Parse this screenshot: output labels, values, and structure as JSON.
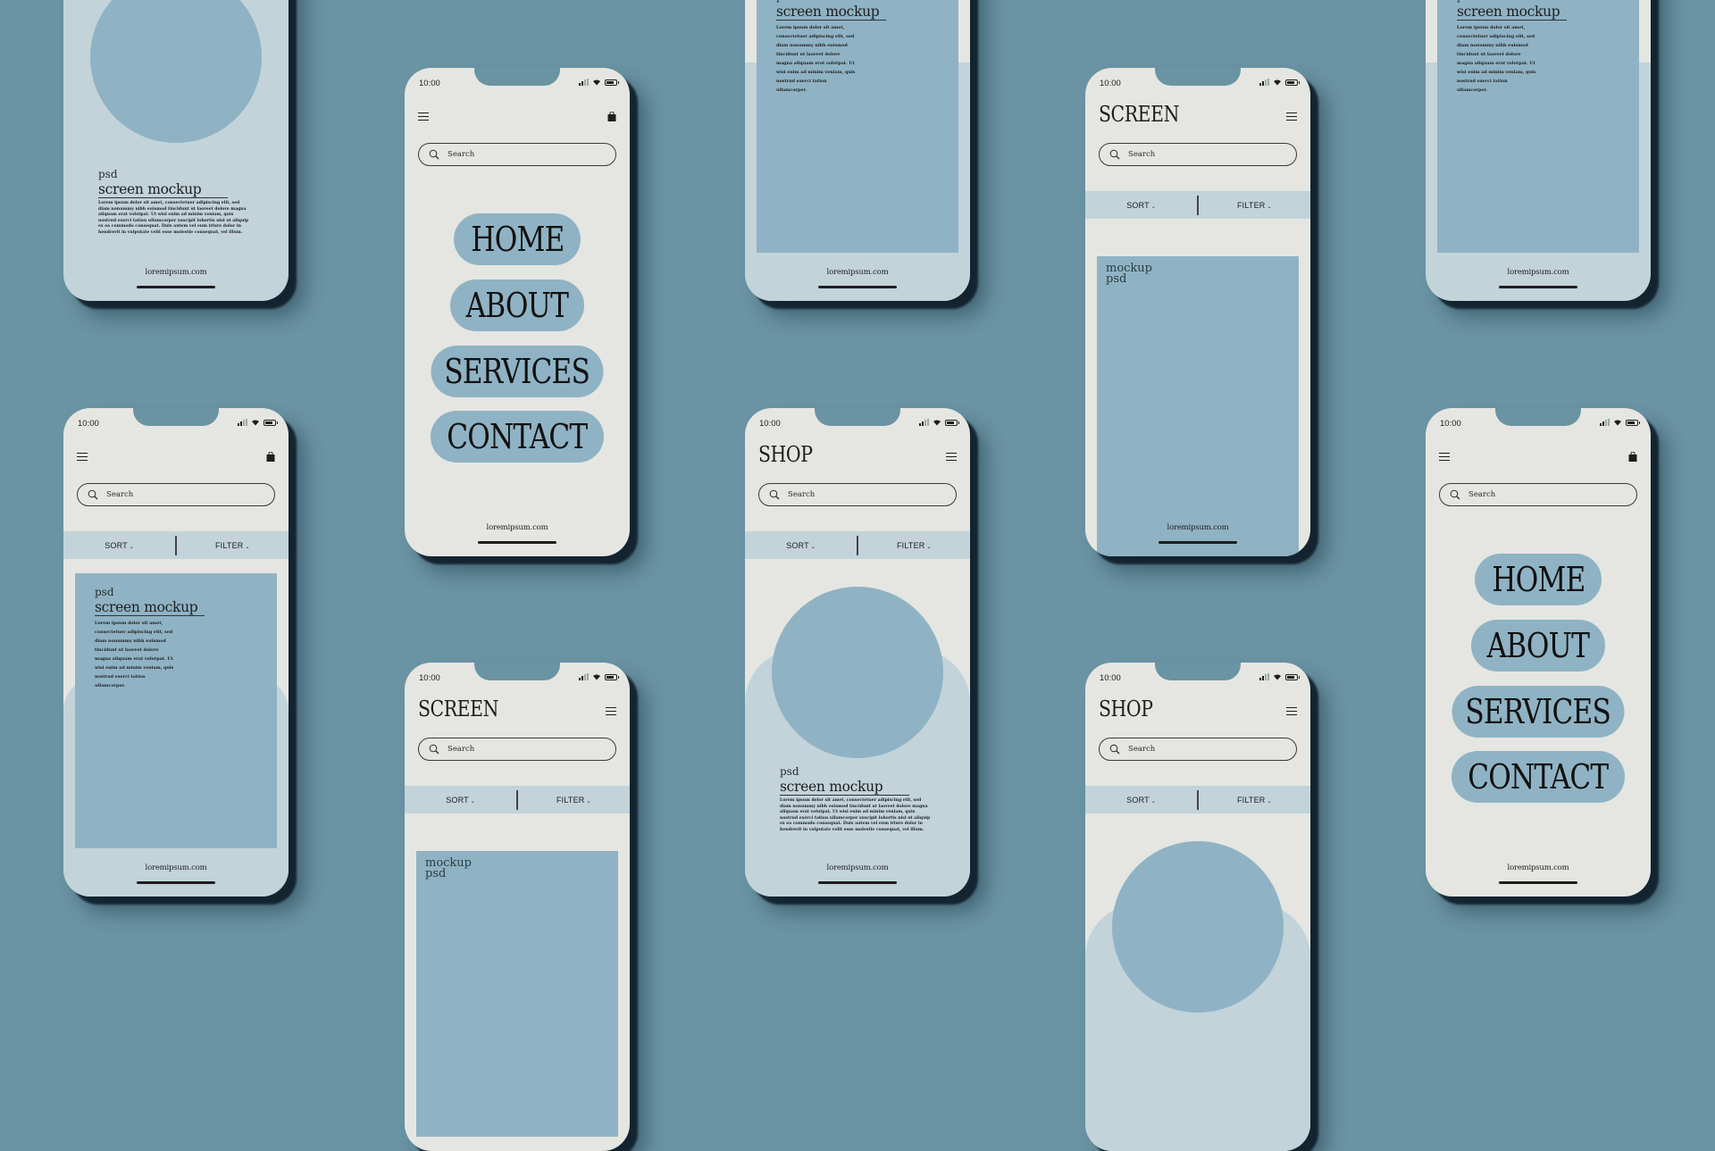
{
  "colors": {
    "background": "#6a93a3",
    "screen": "#e5e6e1",
    "accent": "#8fb3c4",
    "pale": "#c2d3da",
    "ink": "#1d1d1d"
  },
  "status": {
    "time": "10:00"
  },
  "search": {
    "placeholder": "Search"
  },
  "sortbar": {
    "sort": "SORT",
    "filter": "FILTER",
    "chevron": "⌄"
  },
  "brands": {
    "screen": "SCREEN",
    "shop": "SHOP"
  },
  "nav": [
    "HOME",
    "ABOUT",
    "SERVICES",
    "CONTACT"
  ],
  "mockup_block": {
    "line1": "mockup",
    "line2": "psd"
  },
  "article": {
    "kicker": "psd",
    "title": "screen mockup",
    "body_short": "Lorem ipsum dolor sit amet, consectetuer adipiscing elit, sed diam nonummy nibh euismod tincidunt ut laoreet dolore magna aliquam erat volutpat. Ut wisi enim ad minim veniam, quis nostrud exerci tation ullamcorper.",
    "body_long": "Lorem ipsum dolor sit amet, consectetuer adipiscing elit, sed diam nonummy nibh euismod tincidunt ut laoreet dolore magna aliquam erat volutpat. Ut wisi enim ad minim veniam, quis nostrud exerci tation ullamcorper suscipit lobortis nisl ut aliquip ex ea commodo consequat. Duis autem vel eum iriure dolor in hendrerit in vulputate velit esse molestie consequat, vel illum."
  },
  "footer": {
    "url": "loremipsum.com"
  },
  "icons": {
    "menu": "hamburger-icon",
    "bag": "shopping-bag-icon",
    "search": "search-icon",
    "signal": "signal-icon",
    "wifi": "wifi-icon",
    "battery": "battery-icon"
  }
}
